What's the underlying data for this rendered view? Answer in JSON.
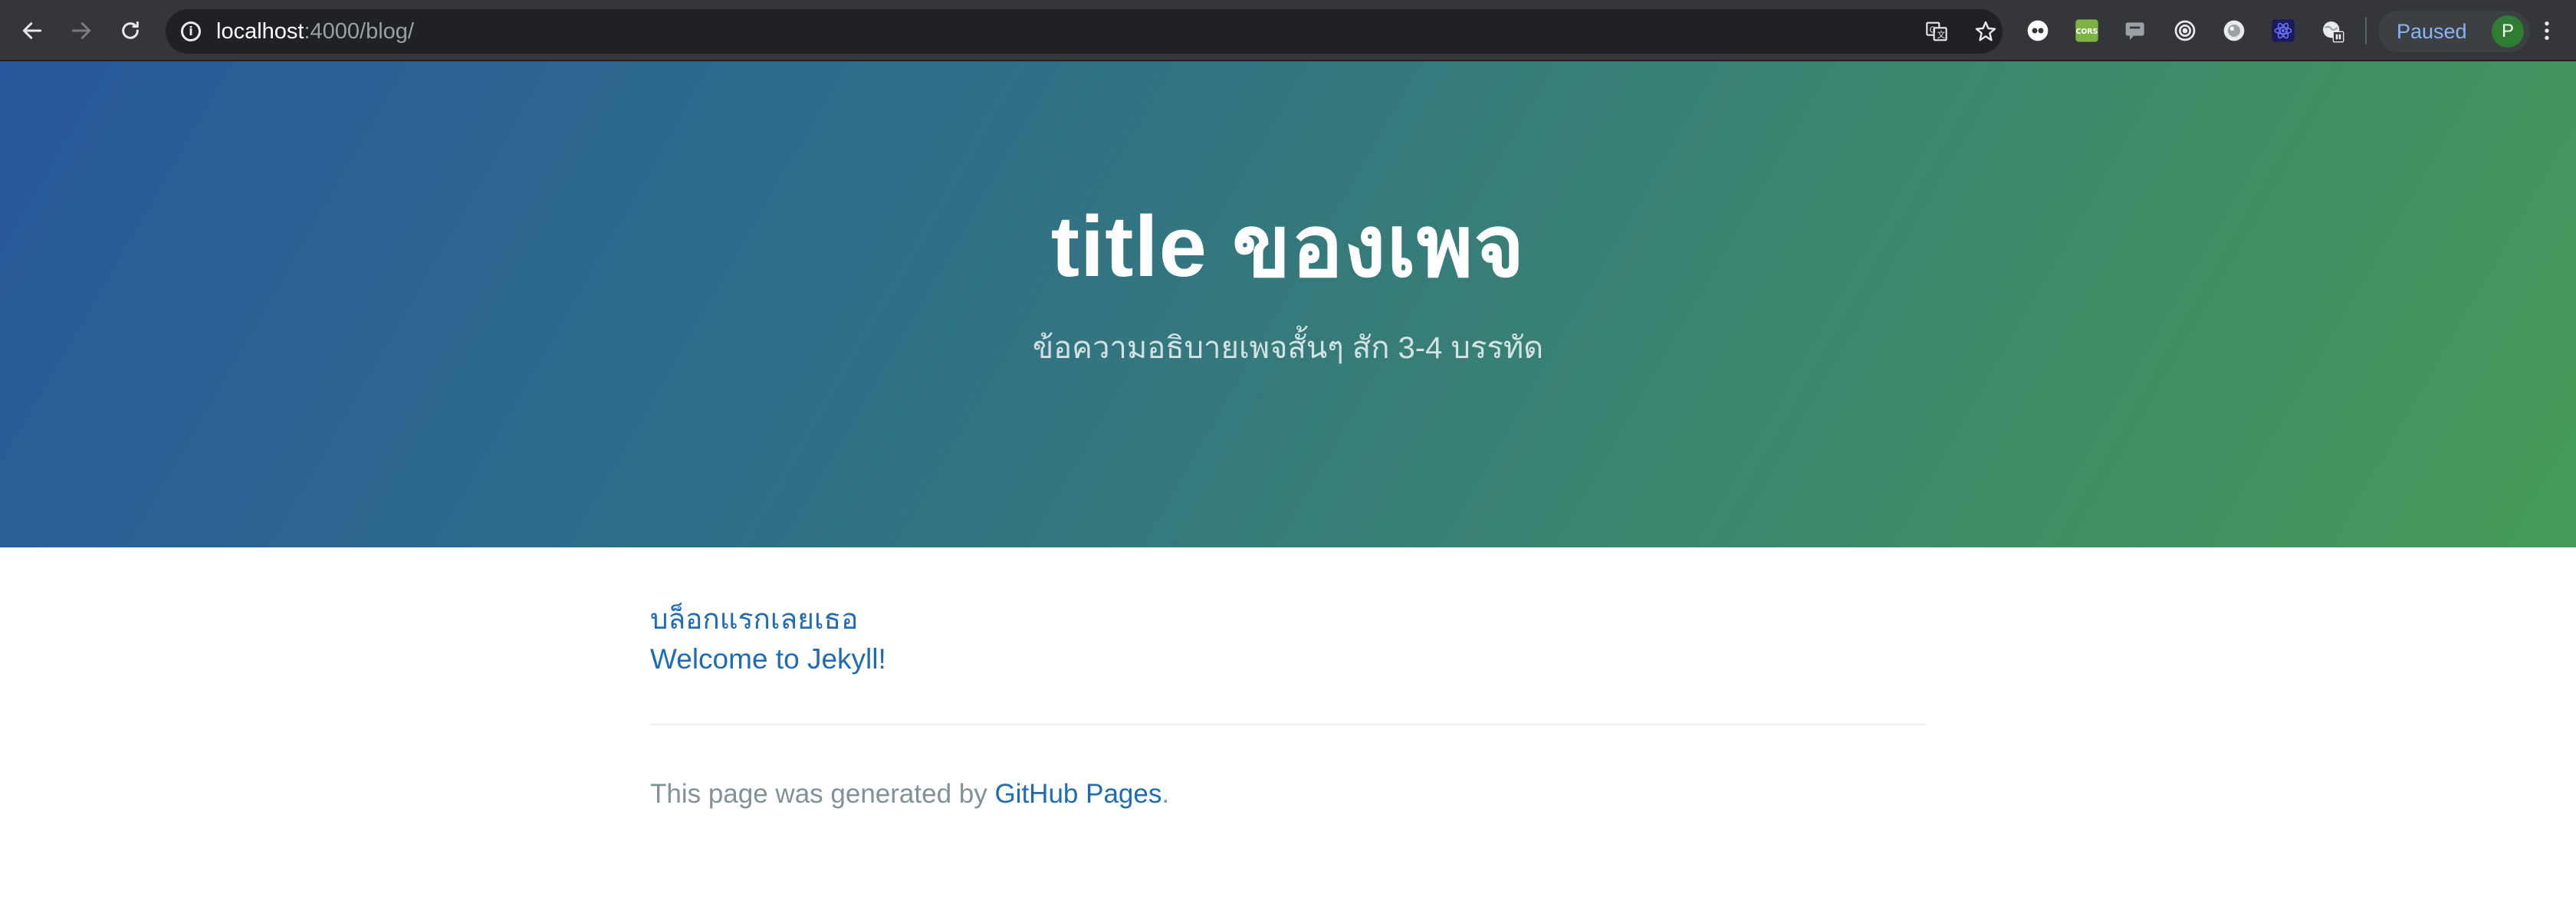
{
  "browser": {
    "url_host": "localhost",
    "url_path": ":4000/blog/",
    "profile_label": "Paused",
    "profile_initial": "P"
  },
  "header": {
    "title": "title ของเพจ",
    "tagline": "ข้อความอธิบายเพจสั้นๆ สัก 3-4 บรรทัด",
    "gradient_start": "#27589b",
    "gradient_end": "#459b58"
  },
  "posts": [
    {
      "title": "บล็อกแรกเลยเธอ"
    },
    {
      "title": "Welcome to Jekyll!"
    }
  ],
  "footer": {
    "text": "This page was generated by ",
    "link_text": "GitHub Pages",
    "suffix": "."
  },
  "colors": {
    "link": "#1e6bb8",
    "footer_text": "#819198"
  }
}
